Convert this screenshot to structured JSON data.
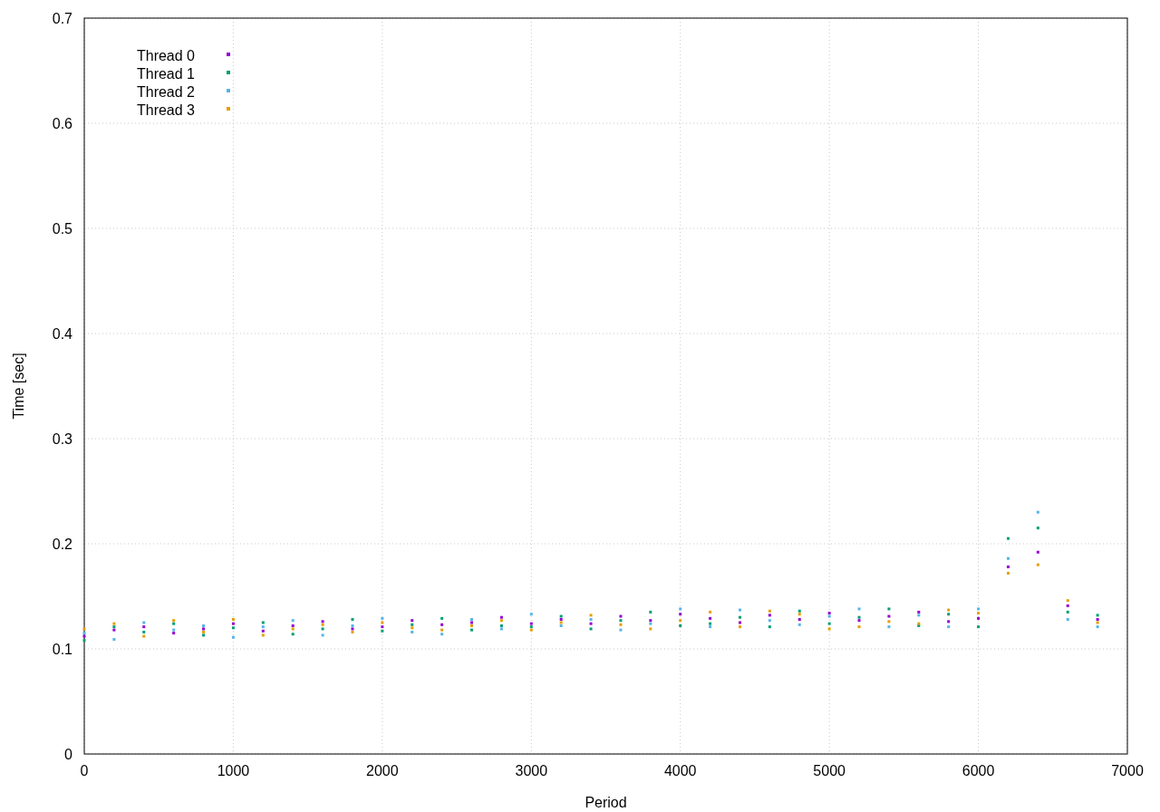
{
  "chart_data": {
    "type": "scatter",
    "xlabel": "Period",
    "ylabel": "Time [sec]",
    "grid": true,
    "legend": true,
    "xlim": [
      0,
      7000
    ],
    "ylim": [
      0,
      0.7
    ],
    "xticks": [
      0,
      1000,
      2000,
      3000,
      4000,
      5000,
      6000,
      7000
    ],
    "yticks": [
      0,
      0.1,
      0.2,
      0.3,
      0.4,
      0.5,
      0.6,
      0.7
    ],
    "x": [
      0,
      200,
      400,
      600,
      800,
      1000,
      1200,
      1400,
      1600,
      1800,
      2000,
      2200,
      2400,
      2600,
      2800,
      3000,
      3200,
      3400,
      3600,
      3800,
      4000,
      4200,
      4400,
      4600,
      4800,
      5000,
      5200,
      5400,
      5600,
      5800,
      6000,
      6200,
      6400,
      6600,
      6800
    ],
    "series": [
      {
        "name": "Thread 0",
        "color": "#9400d3",
        "values": [
          0.112,
          0.118,
          0.121,
          0.115,
          0.119,
          0.124,
          0.117,
          0.122,
          0.126,
          0.119,
          0.121,
          0.127,
          0.123,
          0.125,
          0.13,
          0.124,
          0.128,
          0.124,
          0.131,
          0.127,
          0.133,
          0.129,
          0.125,
          0.132,
          0.128,
          0.134,
          0.127,
          0.131,
          0.135,
          0.126,
          0.129,
          0.178,
          0.192,
          0.141,
          0.128
        ]
      },
      {
        "name": "Thread 1",
        "color": "#009e73",
        "values": [
          0.108,
          0.121,
          0.116,
          0.124,
          0.113,
          0.12,
          0.125,
          0.114,
          0.119,
          0.128,
          0.117,
          0.123,
          0.129,
          0.118,
          0.122,
          0.121,
          0.131,
          0.119,
          0.127,
          0.135,
          0.122,
          0.124,
          0.13,
          0.121,
          0.136,
          0.124,
          0.13,
          0.138,
          0.122,
          0.133,
          0.121,
          0.205,
          0.215,
          0.135,
          0.132
        ]
      },
      {
        "name": "Thread 2",
        "color": "#56b4e9",
        "values": [
          0.115,
          0.109,
          0.125,
          0.118,
          0.122,
          0.111,
          0.121,
          0.127,
          0.113,
          0.122,
          0.129,
          0.116,
          0.114,
          0.128,
          0.119,
          0.133,
          0.122,
          0.128,
          0.118,
          0.124,
          0.138,
          0.121,
          0.137,
          0.127,
          0.123,
          0.131,
          0.138,
          0.121,
          0.132,
          0.121,
          0.138,
          0.186,
          0.23,
          0.128,
          0.121
        ]
      },
      {
        "name": "Thread 3",
        "color": "#e69f00",
        "values": [
          0.119,
          0.124,
          0.112,
          0.127,
          0.116,
          0.128,
          0.113,
          0.119,
          0.123,
          0.116,
          0.125,
          0.12,
          0.118,
          0.122,
          0.127,
          0.118,
          0.125,
          0.132,
          0.123,
          0.119,
          0.127,
          0.135,
          0.121,
          0.136,
          0.133,
          0.119,
          0.121,
          0.126,
          0.124,
          0.137,
          0.134,
          0.172,
          0.18,
          0.146,
          0.125
        ]
      }
    ]
  }
}
